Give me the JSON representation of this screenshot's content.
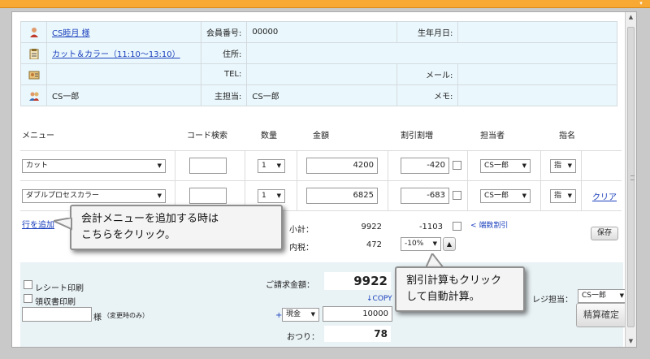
{
  "customer": {
    "name_link": "CS睦月 様",
    "member_no_label": "会員番号:",
    "member_no": "00000",
    "birthday_label": "生年月日:",
    "birthday": "",
    "appointment_link": "カット＆カラー（11:10〜13:10）",
    "address_label": "住所:",
    "address": "",
    "tel_label": "TEL:",
    "tel": "",
    "mail_label": "メール:",
    "mail": "",
    "staff_name": "CS一郎",
    "main_staff_label": "主担当:",
    "main_staff": "CS一郎",
    "memo_label": "メモ:",
    "memo": ""
  },
  "menu_table": {
    "headers": {
      "menu": "メニュー",
      "code_search": "コード検索",
      "qty": "数量",
      "amount": "金額",
      "discount": "割引割増",
      "staff": "担当者",
      "nomination": "指名"
    },
    "rows": [
      {
        "menu": "カット",
        "code": "",
        "qty": "1",
        "amount": "4200",
        "discount": "-420",
        "staff": "CS一郎",
        "nomination": "指",
        "clear": ""
      },
      {
        "menu": "ダブルプロセスカラー",
        "code": "",
        "qty": "1",
        "amount": "6825",
        "discount": "-683",
        "staff": "CS一郎",
        "nomination": "指",
        "clear": "クリア"
      }
    ]
  },
  "summary": {
    "add_row_link": "行を追加",
    "subtotal_label": "小計：",
    "subtotal": "9922",
    "subtotal_discount": "-1103",
    "bulk_discount_link": "< 端数割引",
    "tax_label": "内税：",
    "tax": "472",
    "discount_rate": "-10%",
    "save_button": "保存"
  },
  "footer": {
    "receipt_print": "レシート印刷",
    "invoice_print": "領収書印刷",
    "name_suffix": "様",
    "name_note": "（変更時のみ）",
    "billing_label": "ご請求金額：",
    "billing_amount": "9922",
    "copy_link": "↓COPY",
    "plus": "+",
    "payment_method": "現金",
    "payment_amount": "10000",
    "change_label": "おつり：",
    "change_amount": "78",
    "register_staff_label": "レジ担当：",
    "register_staff": "CS一郎",
    "confirm_button": "精算確定"
  },
  "callouts": {
    "add_menu_line1": "会計メニューを追加する時は",
    "add_menu_line2": "こちらをクリック。",
    "discount_line1": "割引計算もクリック",
    "discount_line2": "して自動計算。"
  },
  "colors": {
    "top_bar": "#f7a934",
    "info_background": "#eaf7fc",
    "link": "#1a3fbd",
    "footer_background": "#e9f2f5"
  }
}
